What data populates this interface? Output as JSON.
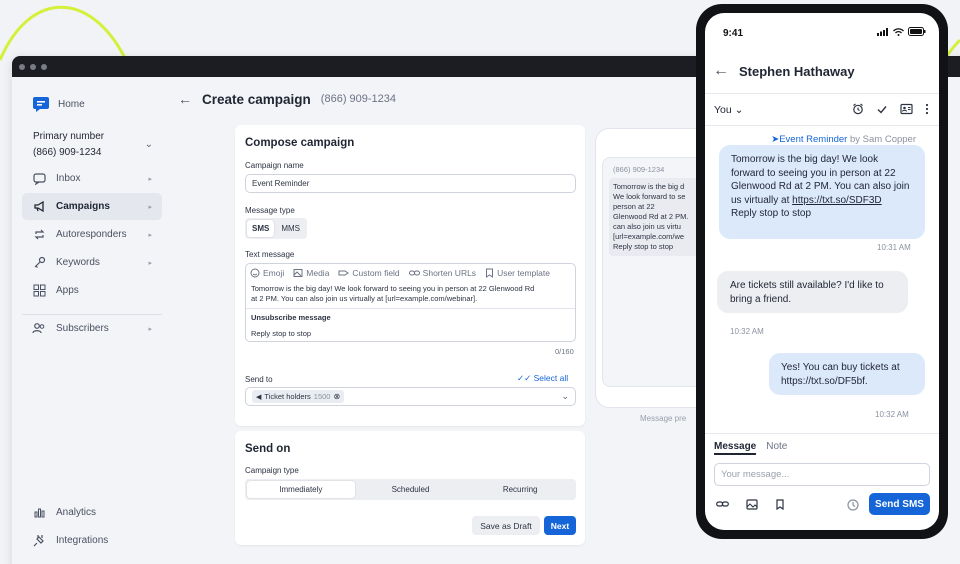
{
  "colors": {
    "accent": "#1565d8",
    "lime": "#d4f03a",
    "dark": "#111216"
  },
  "sidebar": {
    "home": "Home",
    "primary_label": "Primary number",
    "primary_value": "(866) 909-1234",
    "items": [
      {
        "label": "Inbox",
        "icon": "inbox-icon"
      },
      {
        "label": "Campaigns",
        "icon": "megaphone-icon"
      },
      {
        "label": "Autoresponders",
        "icon": "repeat-icon"
      },
      {
        "label": "Keywords",
        "icon": "key-icon"
      },
      {
        "label": "Apps",
        "icon": "grid-icon"
      },
      {
        "label": "Subscribers",
        "icon": "users-icon"
      },
      {
        "label": "Analytics",
        "icon": "bar-chart-icon"
      },
      {
        "label": "Integrations",
        "icon": "plug-icon"
      }
    ]
  },
  "header": {
    "title": "Create campaign",
    "number": "(866) 909-1234"
  },
  "compose": {
    "title": "Compose campaign",
    "name_label": "Campaign name",
    "name_value": "Event Reminder",
    "type_label": "Message type",
    "types": [
      "SMS",
      "MMS"
    ],
    "text_label": "Text message",
    "toolbar": [
      "Emoji",
      "Media",
      "Custom field",
      "Shorten URLs",
      "User template"
    ],
    "message_line1": "Tomorrow is the big day! We look forward to seeing you in person at 22 Glenwood Rd",
    "message_line2": "at 2 PM. You can also join us virtually at [url=example.com/webinar].",
    "unsub_label": "Unsubscribe message",
    "unsub_value": "Reply stop to stop",
    "counter": "0/160",
    "send_to_label": "Send to",
    "select_all": "Select all",
    "chip_label": "Ticket holders",
    "chip_count": "1500"
  },
  "send_on": {
    "title": "Send on",
    "type_label": "Campaign type",
    "options": [
      "Immediately",
      "Scheduled",
      "Recurring"
    ],
    "draft": "Save as Draft",
    "next": "Next"
  },
  "preview": {
    "number": "(866) 909-1234",
    "lines": [
      "Tomorrow is the big d",
      "We look forward to se",
      "person at 22",
      "Glenwood Rd at 2 PM.",
      "can also join us virtu",
      "[url=example.com/we",
      "Reply stop to stop"
    ],
    "caption": "Message pre"
  },
  "phone": {
    "time": "9:41",
    "contact": "Stephen Hathaway",
    "sender": "You",
    "campaign": "Event Reminder",
    "by": "by Sam Copper",
    "msg1_a": "Tomorrow is the big day! We look forward to seeing you in person at 22 Glenwood Rd at 2 PM. You can also join us virtually at ",
    "msg1_link": "https://txt.so/SDF3D",
    "msg1_b": "Reply stop to stop",
    "time1": "10:31 AM",
    "msg2": "Are tickets still available? I'd like to bring a friend.",
    "time2": "10:32 AM",
    "msg3_a": "Yes! You can buy tickets at ",
    "msg3_link": "https://txt.so/DF5bf.",
    "time3": "10:32 AM",
    "tab_message": "Message",
    "tab_note": "Note",
    "input_placeholder": "Your message...",
    "send": "Send SMS"
  }
}
